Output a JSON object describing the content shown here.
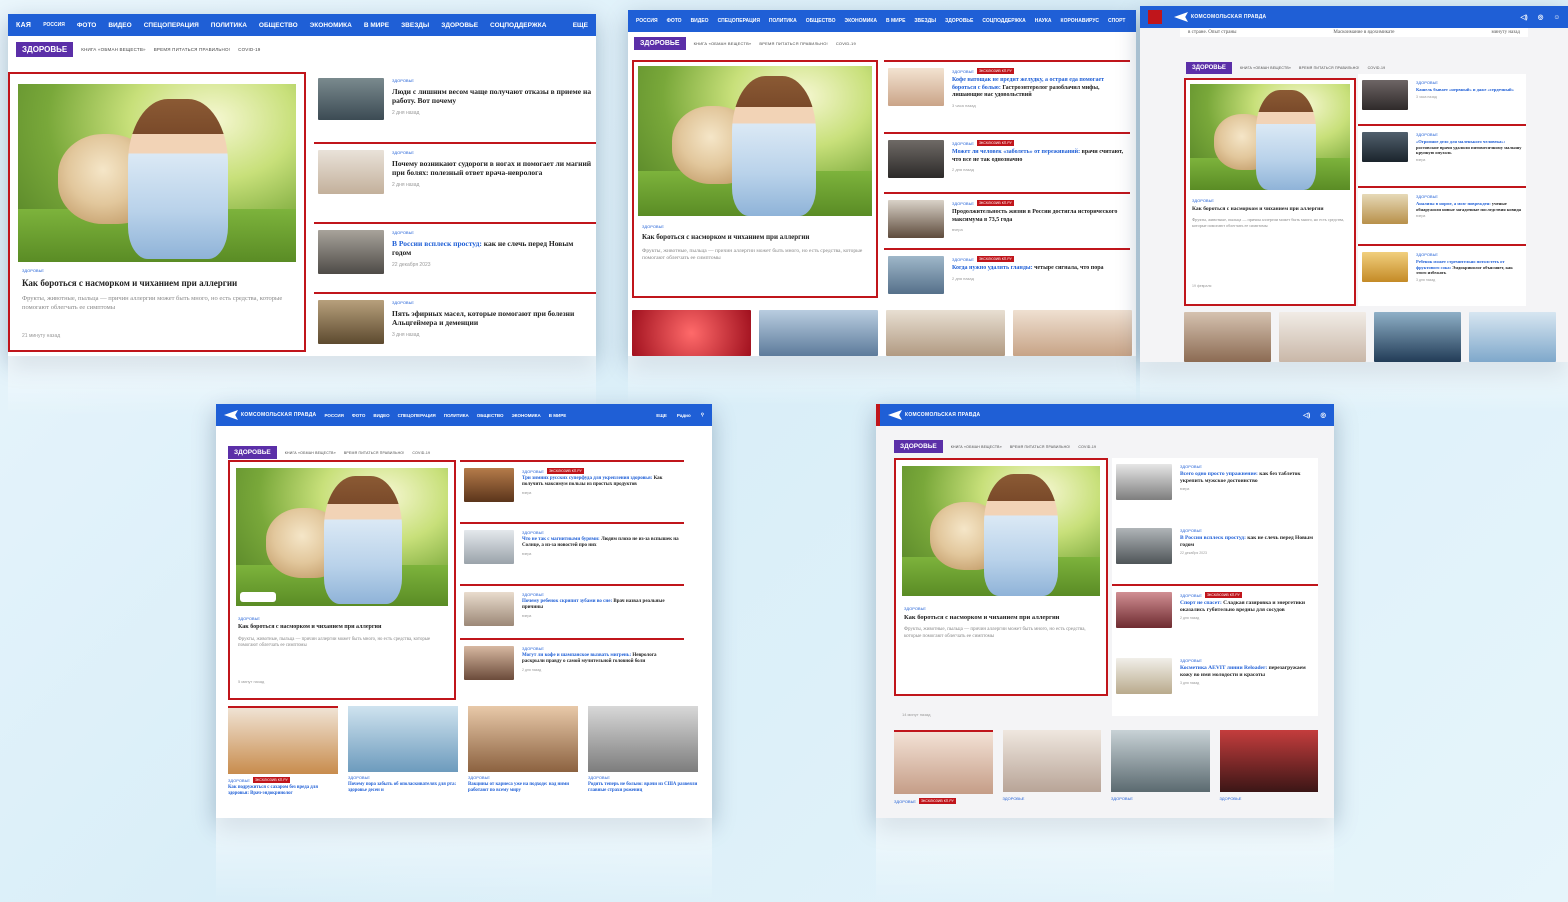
{
  "nav": {
    "logo": "КОМСОМОЛЬСКАЯ ПРАВДА",
    "logo_partial": "КАЯ",
    "region": "РОССИЯ",
    "items": [
      "ФОТО",
      "ВИДЕО",
      "СПЕЦОПЕРАЦИЯ",
      "ПОЛИТИКА",
      "ОБЩЕСТВО",
      "ЭКОНОМИКА",
      "В МИРЕ",
      "ЗВЕЗДЫ",
      "ЗДОРОВЬЕ",
      "СОЦПОДДЕРЖКА"
    ],
    "items_long": [
      "ФОТО",
      "ВИДЕО",
      "СПЕЦОПЕРАЦИЯ",
      "ПОЛИТИКА",
      "ОБЩЕСТВО",
      "ЭКОНОМИКА",
      "В МИРЕ",
      "ЗВЕЗДЫ",
      "ЗДОРОВЬЕ",
      "СОЦПОДДЕРЖКА",
      "НАУКА",
      "КОРОНАВИРУС",
      "СПОРТ"
    ],
    "more": "ЕЩЕ",
    "radio": "Радио"
  },
  "rubric": {
    "title": "ЗДОРОВЬЕ",
    "tags": [
      "КНИГА «ОБМАН ВЕЩЕСТВ»",
      "ВРЕМЯ ПИТАТЬСЯ ПРАВИЛЬНО!",
      "COVID-19"
    ]
  },
  "hero": {
    "label": "ЗДОРОВЬЕ",
    "title": "Как бороться с насморком и чиханием при аллергии",
    "lead": "Фрукты, животные, пыльца — причин аллергии может быть много, но есть средства, которые помогают облегчать ее симптомы",
    "times": [
      "21 минуту назад",
      "14 минут назад",
      "19 февраля",
      "5 минут назад"
    ]
  },
  "label_health": "ЗДОРОВЬЕ",
  "label_expert": "ЭКСКЛЮЗИВ КП.РУ",
  "shot1": {
    "items": [
      {
        "title": "Люди с лишним весом чаще получают отказы в приеме на работу. Вот почему",
        "time": "2 дня назад"
      },
      {
        "title": "Почему возникают судороги в ногах и помогает ли магний при болях: полезный ответ врача-невролога",
        "time": "2 дня назад"
      },
      {
        "hl": "В России всплеск простуд:",
        "title": " как не слечь перед Новым годом",
        "time": "22 декабря 2023"
      },
      {
        "title": "Пять эфирных масел, которые помогают при болезни Альцгеймера и деменции",
        "time": "3 дня назад"
      }
    ]
  },
  "shot2": {
    "items": [
      {
        "hl": "Кофе натощак не вредит желудку, а острая еда помогает бороться с болью:",
        "title": " Гастроэнтеролог разоблачил мифы, лишающие нас удовольствий",
        "time": "3 часа назад"
      },
      {
        "hl": "Может ли человек «заболеть» от переживаний:",
        "title": " врачи считают, что все не так однозначно",
        "time": "2 дня назад"
      },
      {
        "title": "Продолжительность жизни в России достигла исторического максимума в 73,5 года",
        "time": "вчера"
      },
      {
        "hl": "Когда нужно удалять гланды:",
        "title": " четыре сигнала, что пора",
        "time": "2 дня назад"
      }
    ]
  },
  "shot3": {
    "top_left": "в стране. Опыт страны",
    "top_mid": "Маскоимание в ядохимикате",
    "top_right": "минуту назад",
    "items": [
      {
        "hl": "Кашель бывает «нервный» и даже «сердечный»",
        "time": "3 часа назад"
      },
      {
        "hl": "«Огромное дело для маленького человека»:",
        "title": " ростовские врачи удалили пятимесячному малышу крупную опухоль",
        "time": "вчера"
      },
      {
        "hl": "Анализы в норме, а мозг поврежден:",
        "title": " ученые обнаружили новые загадочные последствия ковида",
        "time": "вчера"
      },
      {
        "hl": "Ребенок может стремительно потолстеть от фруктового сока:",
        "title": " Эндокринолог объясняет, как этого избежать",
        "time": "3 дня назад"
      }
    ]
  },
  "shot4": {
    "items": [
      {
        "hl": "Три зимних русских суперфуда для укрепления здоровья:",
        "title": " Как получить максимум пользы из простых продуктов",
        "time": "вчера"
      },
      {
        "hl": "Что не так с магнитными бурями:",
        "title": " Людям плохо не из-за вспышек на Солнце, а из-за новостей про них",
        "time": "вчера"
      },
      {
        "hl": "Почему ребенок скрипит зубами во сне:",
        "title": " Врач назвал реальные причины",
        "time": "вчера"
      },
      {
        "hl": "Могут ли кофе и шампанское вызвать мигрень:",
        "title": " Невролога раскрыли правду о самой мучительной головной боли",
        "time": "2 дня назад"
      }
    ],
    "cards": [
      {
        "title": "Как подружиться с сахаром без вреда для здоровья: Врач-эндокринолог"
      },
      {
        "title": "Почему пора забыть об ополаскивателях для рта: здоровье десен и"
      },
      {
        "title": "Вакцины от кариеса уже на подходе: над ними работают по всему миру"
      },
      {
        "title": "Родить теперь не больно: врачи из США развеяли главные страхи рожениц"
      }
    ]
  },
  "shot5": {
    "items": [
      {
        "hl": "Всего одно просто упражнение:",
        "title": " как без таблеток укрепить мужское достоинство",
        "time": "вчера"
      },
      {
        "hl": "В России всплеск простуд:",
        "title": " как не слечь перед Новым годом",
        "time": "22 декабря 2023"
      },
      {
        "hl": "Спорт не спасет:",
        "title": " Сладкая газировка и энергетики оказались губительно вредны для сосудов",
        "time": "2 дня назад"
      },
      {
        "hl": "Косметика AEVIT линии Reloader:",
        "title": " перезагружаем кожу во имя молодости и красоты",
        "time": "3 дня назад"
      }
    ]
  },
  "colors": {
    "brand": "#1f5fd6",
    "accent": "#c0151b",
    "rubric": "#5b2fa8"
  }
}
